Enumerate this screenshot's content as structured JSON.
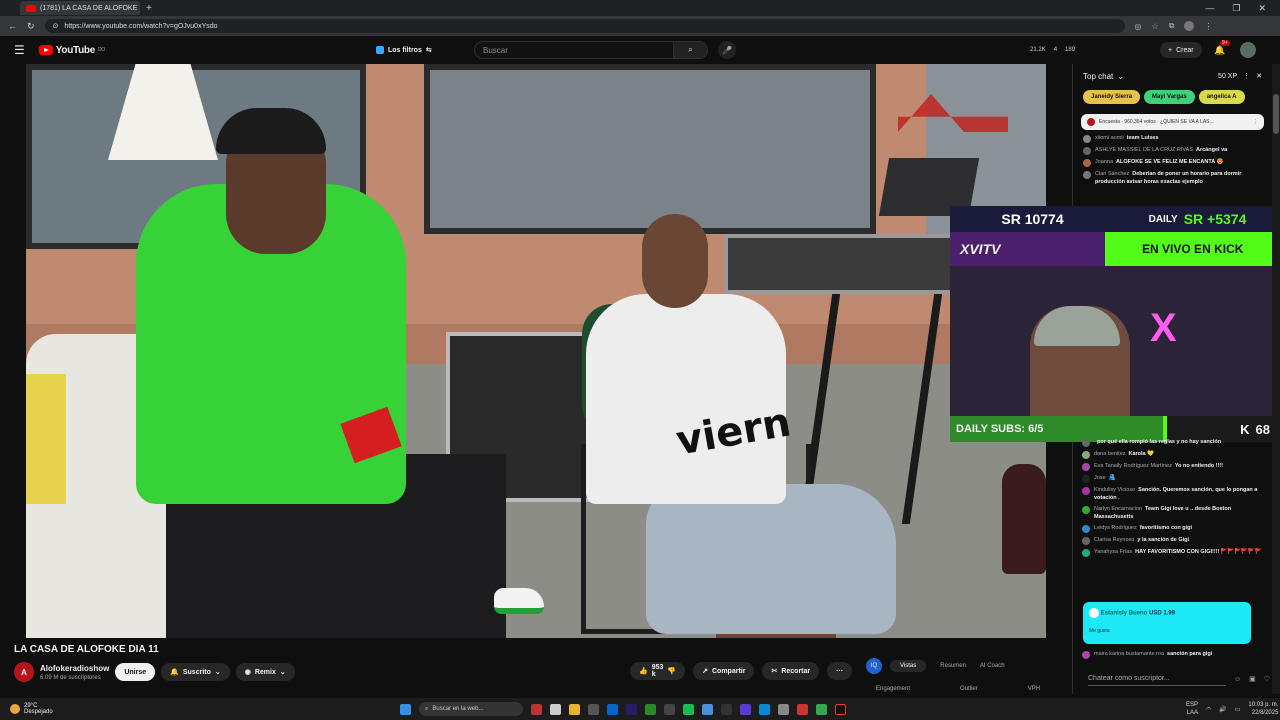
{
  "browser": {
    "tab_title": "(1781) LA CASA DE ALOFOKE",
    "tab_close": "×",
    "new_tab": "+",
    "url": "https://www.youtube.com/watch?v=gOJvu0xYsdo",
    "window_controls": [
      "—",
      "❐",
      "✕"
    ]
  },
  "youtube": {
    "logo_text": "YouTube",
    "logo_sup": "DO",
    "filters_label": "Los filtros",
    "search_placeholder": "Buscar",
    "header_stats": [
      "21.2K",
      "4",
      "189"
    ],
    "create_label": "Crear",
    "notif_badge": "9+"
  },
  "video_overlay": {
    "shirt_text": "viern",
    "sr_left": "SR 10774",
    "sr_right_label": "DAILY",
    "sr_right": "SR +5374",
    "brand": "XVITV",
    "kick_label": "EN VIVO EN KICK",
    "daily_subs": "DAILY SUBS: 6/5",
    "kick_count": "68",
    "neon_mark": "X"
  },
  "info": {
    "title": "LA CASA DE ALOFOKE DIA 11",
    "channel_name": "Alofokeradioshow",
    "channel_subs": "6.09 M de suscriptores",
    "join_label": "Unirse",
    "subscribed_label": "Suscrito",
    "remix_label": "Remix",
    "likes": "953 k",
    "share_label": "Compartir",
    "clip_label": "Recortar",
    "more": "···"
  },
  "ai_panel": {
    "tabs": [
      "Vistas",
      "Resumen",
      "AI Coach"
    ],
    "labels": [
      "Engagement",
      "Outlier",
      "VPH"
    ]
  },
  "chat": {
    "header": "Top chat",
    "xp": "50 XP",
    "pinned": [
      {
        "name": "Janeidy Sierra",
        "color": "#e6c24a"
      },
      {
        "name": "Mayi Vargas",
        "color": "#3fd07a"
      },
      {
        "name": "angelica A",
        "color": "#d9d94c"
      }
    ],
    "poll_text": "Encuesta · 960,364 votos · ¿QUIEN SE VA A LAS...",
    "messages_top": [
      {
        "user": "xiiomi aomii",
        "text": "team Luises",
        "color": "#888"
      },
      {
        "user": "ASHLYE MASSIEL DE LA CRUZ RIVAS",
        "text": "Arcángel va",
        "color": "#666"
      },
      {
        "user": "Joanna",
        "text": "ALOFOKE SE VE FELIZ ME ENCANTA 😍",
        "color": "#aa6644"
      },
      {
        "user": "Clari Sánchez",
        "text": "Deberían de poner un horario para dormir producción avisar horas exactas ejemplo",
        "color": "#777"
      }
    ],
    "messages_bottom": [
      {
        "user": "",
        "text": "por qué ella rompió las reglas y no hay sanción",
        "color": "#666"
      },
      {
        "user": "dana benitez",
        "text": "Karola 💛",
        "color": "#8a7"
      },
      {
        "user": "Eva Tanaily Rodríguez Martínez",
        "text": "Yo no entiendo !!!!",
        "color": "#a4a"
      },
      {
        "user": "Jose",
        "text": "🫂",
        "color": "#222"
      },
      {
        "user": "Kindulisy Vicioso",
        "text": "Sanción. Queremos sanción, que lo pongan a votación .",
        "color": "#a3a"
      },
      {
        "user": "Narlyn Encarnacion",
        "text": "Team Gigi love u .. desde Boston Massachusetts",
        "color": "#3a3"
      },
      {
        "user": "Leidys Rodríguez",
        "text": "favoritismo con gigi",
        "color": "#38c"
      },
      {
        "user": "Clarisa Reynoso",
        "text": "y la sanción de Gigi",
        "color": "#666"
      },
      {
        "user": "Yanahysa Frías",
        "text": "HAY FAVORITISMO CON GIGI!!!! 🚩🚩🚩🚩🚩🚩",
        "color": "#2a8"
      }
    ],
    "donation": {
      "user": "Estanisly Bueno",
      "amount": "USD 1.99",
      "like": "Me gusta"
    },
    "last_message": {
      "user": "maira karina bustamante roa",
      "text": "sanción para gigi"
    },
    "input_placeholder": "Chatear como suscriptor..."
  },
  "taskbar": {
    "temp": "29°C",
    "condition": "Despejado",
    "search_placeholder": "Buscar en la web...",
    "lang": "ESP",
    "lang2": "LAA",
    "time": "10:03 p. m.",
    "date": "22/8/2025"
  }
}
